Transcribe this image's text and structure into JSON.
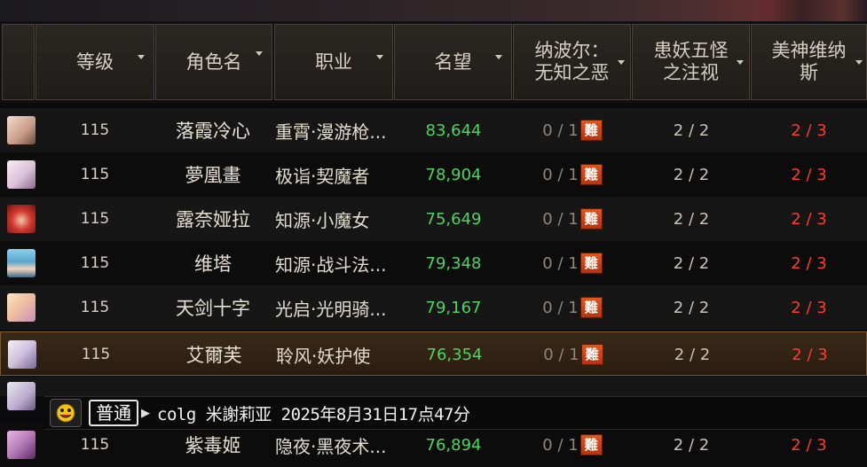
{
  "table": {
    "columns": [
      {
        "id": "level",
        "label": "等级"
      },
      {
        "id": "name",
        "label": "角色名"
      },
      {
        "id": "job",
        "label": "职业"
      },
      {
        "id": "fame",
        "label": "名望"
      },
      {
        "id": "d1",
        "label_line1": "纳波尔：",
        "label_line2": "无知之恶"
      },
      {
        "id": "d2",
        "label_line1": "患妖五怪",
        "label_line2": "之注视"
      },
      {
        "id": "d3",
        "label_line1": "美神维纳",
        "label_line2": "斯"
      }
    ],
    "rows": [
      {
        "level": "115",
        "name": "落霞冷心",
        "job": "重霄·漫游枪...",
        "fame": "83,644",
        "d1": "0 / 1",
        "hard": "難",
        "d2": "2 / 2",
        "d3": "2 / 3",
        "avatar_color": "#d8b7a8"
      },
      {
        "level": "115",
        "name": "夢凰畫",
        "job": "极诣·契魔者",
        "fame": "78,904",
        "d1": "0 / 1",
        "hard": "難",
        "d2": "2 / 2",
        "d3": "2 / 3",
        "avatar_color": "#e6d5e6"
      },
      {
        "level": "115",
        "name": "露奈娅拉",
        "job": "知源·小魔女",
        "fame": "75,649",
        "d1": "0 / 1",
        "hard": "難",
        "d2": "2 / 2",
        "d3": "2 / 3",
        "avatar_color": "#c8322e"
      },
      {
        "level": "115",
        "name": "维塔",
        "job": "知源·战斗法...",
        "fame": "79,348",
        "d1": "0 / 1",
        "hard": "難",
        "d2": "2 / 2",
        "d3": "2 / 3",
        "avatar_color": "#6fb7d8"
      },
      {
        "level": "115",
        "name": "天剑十字",
        "job": "光启·光明骑...",
        "fame": "79,167",
        "d1": "0 / 1",
        "hard": "難",
        "d2": "2 / 2",
        "d3": "2 / 3",
        "avatar_color": "#f0c8a0"
      },
      {
        "level": "115",
        "name": "艾爾芙",
        "job": "聆风·妖护使",
        "fame": "76,354",
        "d1": "0 / 1",
        "hard": "難",
        "d2": "2 / 2",
        "d3": "2 / 3",
        "avatar_color": "#c9b8d8"
      },
      {
        "level": "115",
        "name": "紫毒姬",
        "job": "隐夜·黑夜术...",
        "fame": "76,894",
        "d1": "0 / 1",
        "hard": "難",
        "d2": "2 / 2",
        "d3": "2 / 3",
        "avatar_color": "#b47ab8"
      }
    ]
  },
  "chat": {
    "channel": "普通",
    "message": "colg 米謝莉亚 2025年8月31日17点47分",
    "icon": "smiley-face-icon"
  },
  "colors": {
    "fame": "#4fd45e",
    "d3": "#ff3b30",
    "hard_badge": "#d2471a"
  }
}
